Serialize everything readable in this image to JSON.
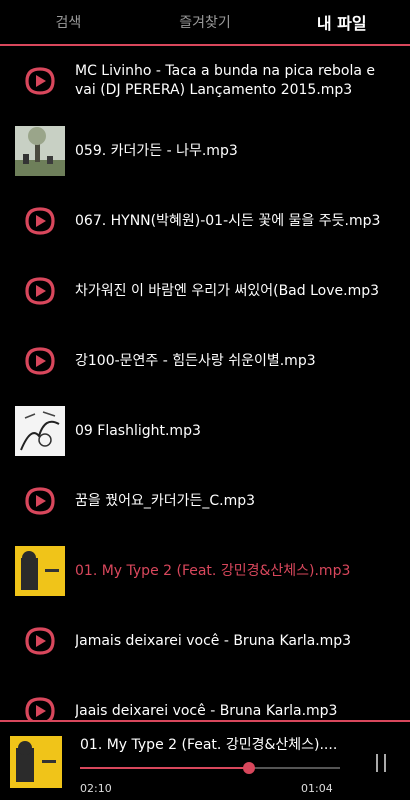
{
  "tabs": [
    {
      "label": "검색"
    },
    {
      "label": "즐겨찾기"
    },
    {
      "label": "내 파일"
    }
  ],
  "active_tab": 2,
  "files": [
    {
      "title": "MC Livinho - Taca a bunda na pica rebola e vai (DJ PERERA) Lançamento 2015.mp3",
      "art": "app-logo-icon"
    },
    {
      "title": "059. 카더가든 - 나무.mp3",
      "art": "photo-tree-thumbnail"
    },
    {
      "title": "067. HYNN(박혜원)-01-시든 꽃에 물을 주듯.mp3",
      "art": "app-logo-icon"
    },
    {
      "title": "차가워진 이 바람엔 우리가 써있어(Bad Love.mp3",
      "art": "app-logo-icon"
    },
    {
      "title": "강100-문연주 - 힘든사랑 쉬운이별.mp3",
      "art": "app-logo-icon"
    },
    {
      "title": "09 Flashlight.mp3",
      "art": "album-art-sketch"
    },
    {
      "title": "꿈을 꿨어요_카더가든_C.mp3",
      "art": "app-logo-icon"
    },
    {
      "title": "01. My Type 2 (Feat. 강민경&산체스).mp3",
      "art": "album-art-yellow"
    },
    {
      "title": "Jamais deixarei você - Bruna Karla.mp3",
      "art": "app-logo-icon"
    },
    {
      "title": "Jaais deixarei você - Bruna Karla.mp3",
      "art": "app-logo-icon"
    }
  ],
  "playing_index": 7,
  "now_playing": {
    "title": "01. My Type 2 (Feat. 강민경&산체스)....",
    "elapsed": "02:10",
    "remaining": "01:04",
    "progress": 0.65
  },
  "colors": {
    "accent": "#d8475c",
    "background": "#000000"
  }
}
